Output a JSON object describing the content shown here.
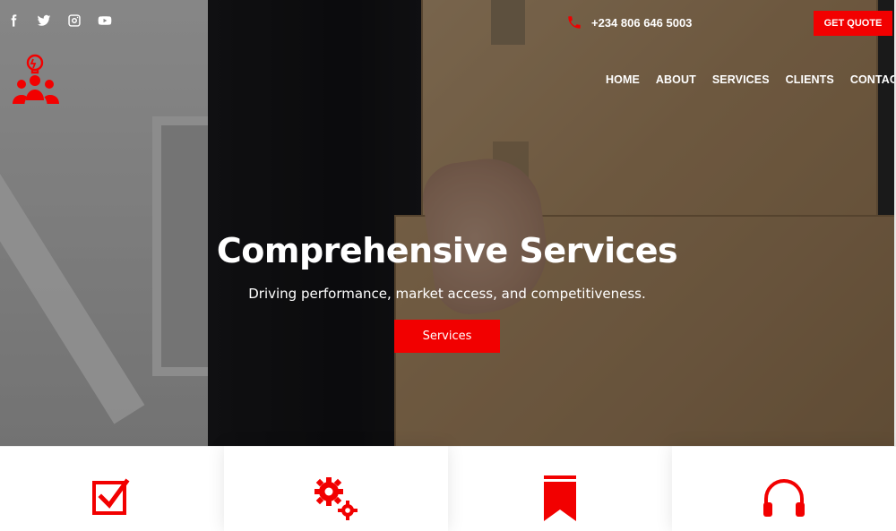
{
  "topbar": {
    "social": [
      "facebook-icon",
      "twitter-icon",
      "instagram-icon",
      "youtube-icon"
    ],
    "phone": "+234 806 646 5003",
    "cta_label": "GET QUOTE"
  },
  "nav": {
    "items": [
      "HOME",
      "ABOUT",
      "SERVICES",
      "CLIENTS",
      "CONTACT"
    ]
  },
  "hero": {
    "title": "Comprehensive Services",
    "subtitle": "Driving performance, market access, and competitiveness.",
    "button_label": "Services"
  },
  "features": {
    "icons": [
      "checkbox-icon",
      "gears-icon",
      "bookmark-icon",
      "headphones-icon"
    ]
  },
  "colors": {
    "accent": "#f20000",
    "white": "#ffffff"
  }
}
